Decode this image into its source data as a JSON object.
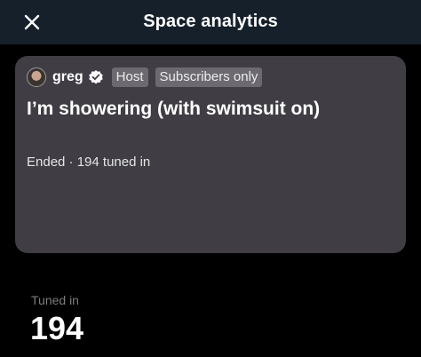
{
  "header": {
    "title": "Space analytics",
    "close_icon": "close-icon"
  },
  "space": {
    "host": {
      "name": "greg",
      "verified_icon": "verified-badge-icon",
      "avatar_icon": "avatar"
    },
    "badges": [
      "Host",
      "Subscribers only"
    ],
    "title": "I’m showering (with swimsuit on)",
    "status": "Ended · 194 tuned in"
  },
  "stats": {
    "tuned_in_label": "Tuned in",
    "tuned_in_value": "194"
  },
  "colors": {
    "background": "#000000",
    "header_bg": "#15202b",
    "card_bg": "#403e44",
    "badge_bg": "#6c6a70",
    "muted_text": "#7c7c80"
  }
}
